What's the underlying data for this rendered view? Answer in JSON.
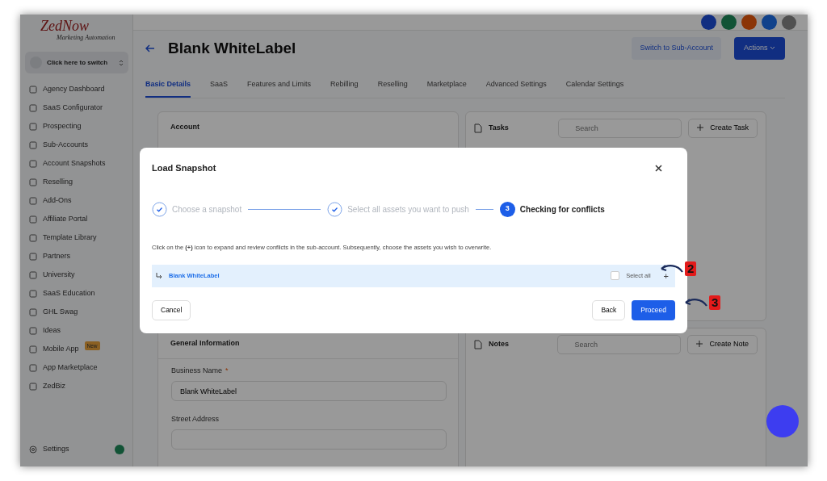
{
  "brand": {
    "name": "ZedNow",
    "tagline": "Marketing Automation"
  },
  "switcher": {
    "label": "Click here to switch"
  },
  "sidebar": {
    "items": [
      {
        "label": "Agency Dashboard",
        "selected": false
      },
      {
        "label": "SaaS Configurator",
        "selected": false
      },
      {
        "label": "Prospecting",
        "selected": false
      },
      {
        "label": "Sub-Accounts",
        "selected": false
      },
      {
        "label": "Account Snapshots",
        "selected": false
      },
      {
        "label": "Reselling",
        "selected": false
      },
      {
        "label": "Add-Ons",
        "selected": false
      },
      {
        "label": "Affiliate Portal",
        "selected": false
      },
      {
        "label": "Template Library",
        "selected": false
      },
      {
        "label": "Partners",
        "selected": false
      },
      {
        "label": "University",
        "selected": false
      },
      {
        "label": "SaaS Education",
        "selected": false
      },
      {
        "label": "GHL Swag",
        "selected": false
      },
      {
        "label": "Ideas",
        "selected": false
      },
      {
        "label": "Mobile App",
        "selected": false,
        "badge": "New"
      },
      {
        "label": "App Marketplace",
        "selected": false
      },
      {
        "label": "ZedBiz",
        "selected": false
      }
    ],
    "settings": "Settings"
  },
  "page": {
    "title": "Blank WhiteLabel",
    "switch_button": "Switch to Sub-Account",
    "actions_button": "Actions"
  },
  "tabs": [
    {
      "label": "Basic Details",
      "selected": true
    },
    {
      "label": "SaaS",
      "selected": false
    },
    {
      "label": "Features and Limits",
      "selected": false
    },
    {
      "label": "Rebilling",
      "selected": false
    },
    {
      "label": "Reselling",
      "selected": false
    },
    {
      "label": "Marketplace",
      "selected": false
    },
    {
      "label": "Advanced Settings",
      "selected": false
    },
    {
      "label": "Calendar Settings",
      "selected": false
    }
  ],
  "account_card": {
    "title": "Account"
  },
  "tasks": {
    "title": "Tasks",
    "search_placeholder": "Search",
    "create_button": "Create Task"
  },
  "general_information": {
    "title": "General Information",
    "fields": [
      {
        "label": "Business Name",
        "required_mark": "*",
        "value": "Blank WhiteLabel"
      },
      {
        "label": "Street Address"
      }
    ]
  },
  "notes": {
    "title": "Notes",
    "search_placeholder": "Search",
    "create_button": "Create Note"
  },
  "modal": {
    "title": "Load Snapshot",
    "steps": [
      {
        "label": "Choose a snapshot",
        "done": true
      },
      {
        "label": "Select all assets you want to push",
        "done": true
      },
      {
        "label": "Checking for conflicts",
        "done": false,
        "number": "3"
      }
    ],
    "instructions": "Click on the **(+)** icon to expand and review conflicts in the sub-account. Subsequently, choose the assets you wish to overwrite.",
    "account_row": {
      "label": "Blank WhiteLabel",
      "select_all": "Select all",
      "checked": false,
      "expand": "+"
    },
    "cancel_button": "Cancel",
    "back_button": "Back",
    "proceed_button": "Proceed"
  },
  "annotations": [
    {
      "number": "2"
    },
    {
      "number": "3"
    }
  ]
}
